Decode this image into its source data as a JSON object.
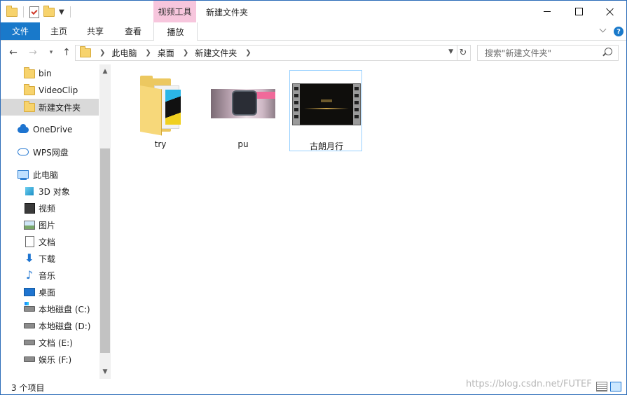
{
  "window": {
    "title": "新建文件夹",
    "contextual_tab_group": "视频工具"
  },
  "ribbon": {
    "tabs": [
      "文件",
      "主页",
      "共享",
      "查看",
      "播放"
    ],
    "help_label": "?"
  },
  "navigation": {
    "breadcrumb": [
      "此电脑",
      "桌面",
      "新建文件夹"
    ],
    "search_placeholder": "搜索\"新建文件夹\""
  },
  "sidebar": {
    "items": [
      {
        "label": "bin",
        "icon": "folder-icon"
      },
      {
        "label": "VideoClip",
        "icon": "folder-icon"
      },
      {
        "label": "新建文件夹",
        "icon": "folder-icon",
        "selected": true
      },
      {
        "label": "OneDrive",
        "icon": "onedrive-icon"
      },
      {
        "label": "WPS网盘",
        "icon": "wps-cloud-icon"
      },
      {
        "label": "此电脑",
        "icon": "this-pc-icon"
      },
      {
        "label": "3D 对象",
        "icon": "3d-objects-icon"
      },
      {
        "label": "视频",
        "icon": "videos-icon"
      },
      {
        "label": "图片",
        "icon": "pictures-icon"
      },
      {
        "label": "文档",
        "icon": "documents-icon"
      },
      {
        "label": "下载",
        "icon": "downloads-icon"
      },
      {
        "label": "音乐",
        "icon": "music-icon"
      },
      {
        "label": "桌面",
        "icon": "desktop-icon"
      },
      {
        "label": "本地磁盘 (C:)",
        "icon": "drive-c-icon"
      },
      {
        "label": "本地磁盘 (D:)",
        "icon": "drive-icon"
      },
      {
        "label": "文档 (E:)",
        "icon": "drive-icon"
      },
      {
        "label": "娱乐 (F:)",
        "icon": "drive-icon"
      }
    ]
  },
  "files": [
    {
      "name": "try",
      "type": "folder"
    },
    {
      "name": "pu",
      "type": "image"
    },
    {
      "name": "古朗月行",
      "type": "video",
      "selected": true
    }
  ],
  "status": {
    "item_count": "3 个项目"
  },
  "watermark": "https://blog.csdn.net/FUTEF",
  "colors": {
    "accent": "#1979ca",
    "contextual_tab": "#f7c6dd",
    "selection_border": "#99d1ff"
  }
}
